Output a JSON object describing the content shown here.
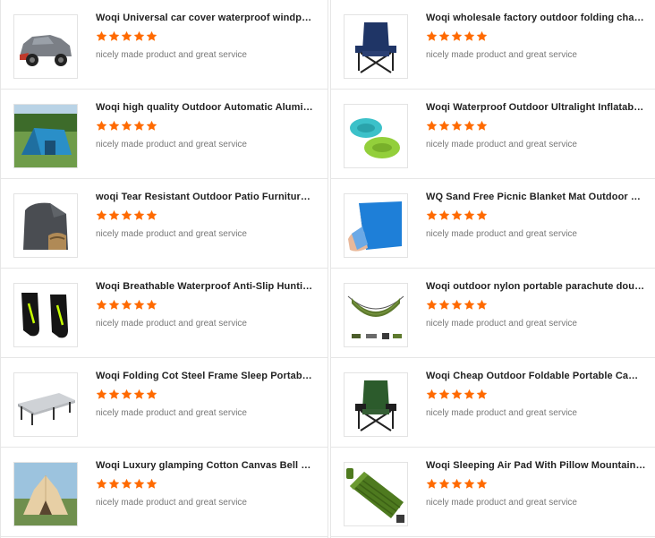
{
  "star_color": "#ff6a00",
  "left_products": [
    {
      "title": "Woqi Universal car cover waterproof windproof...",
      "rating": 5,
      "review": "nicely made product and great service",
      "icon": "car-cover-image"
    },
    {
      "title": "Woqi high quality Outdoor Automatic Aluminu...",
      "rating": 5,
      "review": "nicely made product and great service",
      "icon": "tent-image"
    },
    {
      "title": "woqi Tear Resistant Outdoor Patio Furniture Co...",
      "rating": 5,
      "review": "nicely made product and great service",
      "icon": "furniture-cover-image"
    },
    {
      "title": "Woqi Breathable Waterproof Anti-Slip Hunting ...",
      "rating": 5,
      "review": "nicely made product and great service",
      "icon": "gaiters-image"
    },
    {
      "title": "Woqi Folding Cot Steel Frame Sleep Portable Military ...",
      "rating": 5,
      "review": "nicely made product and great service",
      "icon": "folding-cot-image"
    },
    {
      "title": "Woqi Luxury glamping Cotton Canvas Bell Tent...",
      "rating": 5,
      "review": "nicely made product and great service",
      "icon": "bell-tent-image"
    }
  ],
  "right_products": [
    {
      "title": "Woqi wholesale factory outdoor folding chair c...",
      "rating": 5,
      "review": "nicely made product and great service",
      "icon": "folding-chair-image"
    },
    {
      "title": "Woqi Waterproof Outdoor Ultralight Inflatable T...",
      "rating": 5,
      "review": "nicely made product and great service",
      "icon": "inflatable-pillow-image"
    },
    {
      "title": "WQ Sand Free Picnic Blanket Mat Outdoor Ca...",
      "rating": 5,
      "review": "nicely made product and great service",
      "icon": "picnic-blanket-image"
    },
    {
      "title": "Woqi outdoor nylon portable parachute double ...",
      "rating": 5,
      "review": "nicely made product and great service",
      "icon": "hammock-image"
    },
    {
      "title": "Woqi Cheap Outdoor Foldable Portable Camp ...",
      "rating": 5,
      "review": "nicely made product and great service",
      "icon": "camp-chair-image"
    },
    {
      "title": "Woqi Sleeping Air Pad With Pillow Mountain Cli...",
      "rating": 5,
      "review": "nicely made product and great service",
      "icon": "sleeping-pad-image"
    }
  ]
}
